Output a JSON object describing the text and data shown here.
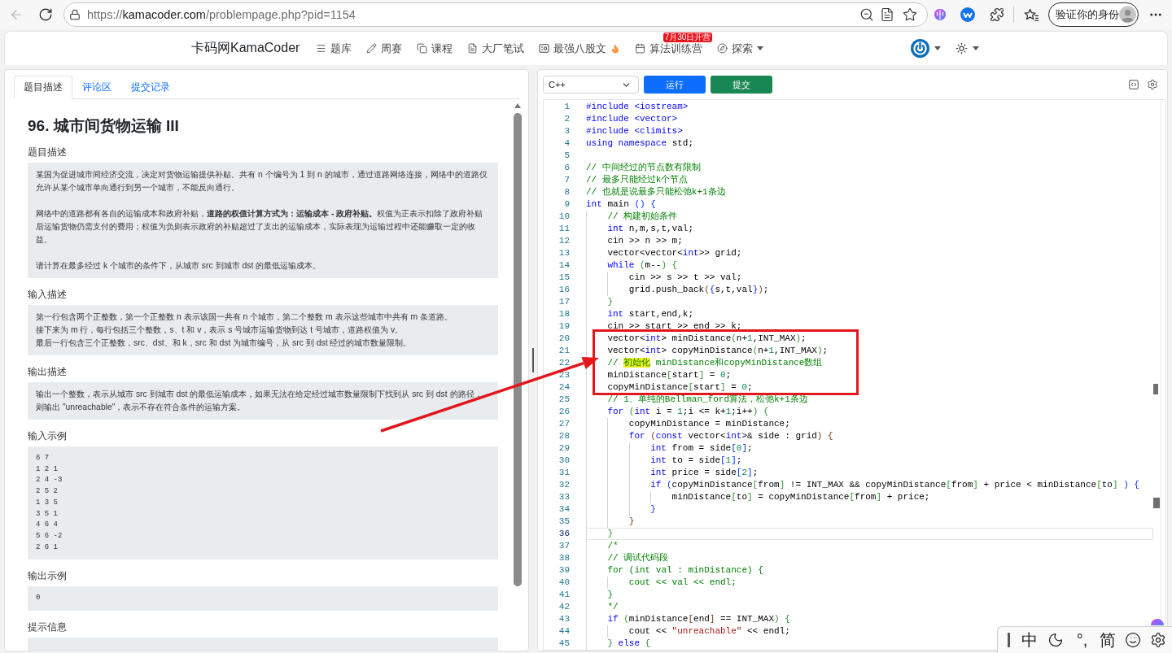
{
  "browser": {
    "back_button": {
      "disabled": true
    },
    "address": {
      "scheme": "https://",
      "host": "kamacoder.com",
      "path": "/problempage.php?pid=1154"
    },
    "profile_button": "验证你的身份"
  },
  "navbar": {
    "brand": "卡码网KamaCoder",
    "items": [
      {
        "label": "题库",
        "kind": "link"
      },
      {
        "label": "周赛",
        "kind": "link"
      },
      {
        "label": "课程",
        "kind": "link"
      },
      {
        "label": "大厂笔试",
        "kind": "link"
      },
      {
        "label": "最强八股文",
        "kind": "hot"
      },
      {
        "label": "算法训练营",
        "kind": "link",
        "badge": "7月30日开营"
      },
      {
        "label": "探索",
        "kind": "dropdown"
      }
    ]
  },
  "problem_panel": {
    "tabs": [
      {
        "label": "题目描述",
        "selected": true
      },
      {
        "label": "评论区",
        "selected": false
      },
      {
        "label": "提交记录",
        "selected": false
      }
    ],
    "title": "96. 城市间货物运输 III",
    "sections": [
      {
        "heading": "题目描述",
        "kind": "prose",
        "paragraphs": [
          "某国为促进城市间经济交流，决定对货物运输提供补贴。共有 n 个编号为 1 到 n 的城市，通过道路网络连接，网络中的道路仅允许从某个城市单向通行到另一个城市，不能反向通行。",
          "网络中的道路都有各自的运输成本和政府补贴，**道路的权值计算方式为：运输成本 - 政府补贴。**权值为正表示扣除了政府补贴后运输货物仍需支付的费用；权值为负则表示政府的补贴超过了支出的运输成本，实际表现为运输过程中还能赚取一定的收益。",
          "请计算在最多经过 k 个城市的条件下，从城市 src 到城市 dst 的最低运输成本。"
        ]
      },
      {
        "heading": "输入描述",
        "kind": "lines",
        "paragraphs": [
          "第一行包含两个正整数，第一个正整数 n 表示该国一共有 n 个城市，第二个整数 m 表示这些城市中共有 m 条道路。",
          "接下来为 m 行，每行包括三个整数，s、t 和 v，表示 s 号城市运输货物到达 t 号城市，道路权值为 v。",
          "最后一行包含三个正整数，src、dst、和 k，src 和 dst 为城市编号，从 src 到 dst 经过的城市数量限制。"
        ]
      },
      {
        "heading": "输出描述",
        "kind": "lines",
        "paragraphs": [
          "输出一个整数，表示从城市 src 到城市 dst 的最低运输成本，如果无法在给定经过城市数量限制下找到从 src 到 dst 的路径，则输出 \"unreachable\"，表示不存在符合条件的运输方案。"
        ]
      },
      {
        "heading": "输入示例",
        "kind": "sample",
        "paragraphs": [
          "6 7",
          "1 2 1",
          "2 4 -3",
          "2 5 2",
          "1 3 5",
          "3 5 1",
          "4 6 4",
          "5 6 -2",
          "2 6 1"
        ]
      },
      {
        "heading": "输出示例",
        "kind": "sample",
        "paragraphs": [
          "0"
        ]
      },
      {
        "heading": "提示信息",
        "kind": "prose"
      }
    ]
  },
  "editor": {
    "language": "C++",
    "buttons": [
      {
        "label": "运行",
        "kind": "primary"
      },
      {
        "label": "提交",
        "kind": "success"
      }
    ],
    "lines": [
      {
        "number": "1",
        "active": false,
        "tokens": [
          {
            "kind": "kw",
            "text": "#include <iostream>"
          }
        ]
      },
      {
        "number": "2",
        "active": false,
        "tokens": [
          {
            "kind": "kw",
            "text": "#include <vector>"
          }
        ]
      },
      {
        "number": "3",
        "active": false,
        "tokens": [
          {
            "kind": "kw",
            "text": "#include <climits>"
          }
        ]
      },
      {
        "number": "4",
        "active": false,
        "tokens": [
          {
            "kind": "kw",
            "text": "using namespace"
          },
          {
            "kind": "txt",
            "text": " std;"
          }
        ]
      },
      {
        "number": "5",
        "active": false
      },
      {
        "number": "6",
        "active": false,
        "tokens": [
          {
            "kind": "cm",
            "text": "// 中间经过的节点数有限制"
          }
        ]
      },
      {
        "number": "7",
        "active": false,
        "tokens": [
          {
            "kind": "cm",
            "text": "// 最多只能经过k个节点"
          }
        ]
      },
      {
        "number": "8",
        "active": false,
        "tokens": [
          {
            "kind": "cm",
            "text": "// 也就是说最多只能松弛k+1条边"
          }
        ]
      },
      {
        "number": "9",
        "active": false,
        "tokens": [
          {
            "kind": "kw",
            "text": "int"
          },
          {
            "kind": "txt",
            "text": " main "
          },
          {
            "kind": "b1",
            "text": "() {"
          }
        ],
        "children": [
          {
            "number": "10",
            "active": false,
            "tokens": [
              {
                "kind": "cm",
                "text": "// 构建初始条件"
              }
            ]
          },
          {
            "number": "11",
            "active": false,
            "tokens": [
              {
                "kind": "kw",
                "text": "int"
              },
              {
                "kind": "txt",
                "text": " n,m,s,t,val;"
              }
            ]
          },
          {
            "number": "12",
            "active": false,
            "tokens": [
              {
                "kind": "txt",
                "text": "cin >> n >> m;"
              }
            ]
          },
          {
            "number": "13",
            "active": false,
            "tokens": [
              {
                "kind": "txt",
                "text": "vector<vector<"
              },
              {
                "kind": "kw",
                "text": "int"
              },
              {
                "kind": "txt",
                "text": ">> grid;"
              }
            ]
          },
          {
            "number": "14",
            "active": false,
            "tokens": [
              {
                "kind": "kw",
                "text": "while"
              },
              {
                "kind": "b2",
                "text": " ("
              },
              {
                "kind": "txt",
                "text": "m--"
              },
              {
                "kind": "b2",
                "text": ") {"
              }
            ],
            "children": [
              {
                "number": "15",
                "active": false,
                "tokens": [
                  {
                    "kind": "txt",
                    "text": "cin >> s >> t >> val;"
                  }
                ]
              },
              {
                "number": "16",
                "active": false,
                "tokens": [
                  {
                    "kind": "txt",
                    "text": "grid.push_back"
                  },
                  {
                    "kind": "b3",
                    "text": "("
                  },
                  {
                    "kind": "b1",
                    "text": "{"
                  },
                  {
                    "kind": "txt",
                    "text": "s,t,val"
                  },
                  {
                    "kind": "b1",
                    "text": "}"
                  },
                  {
                    "kind": "b3",
                    "text": ")"
                  },
                  {
                    "kind": "txt",
                    "text": ";"
                  }
                ]
              }
            ]
          },
          {
            "number": "17",
            "active": false,
            "tokens": [
              {
                "kind": "b2",
                "text": "}"
              }
            ]
          },
          {
            "number": "18",
            "active": false,
            "tokens": [
              {
                "kind": "kw",
                "text": "int"
              },
              {
                "kind": "txt",
                "text": " start,end,k;"
              }
            ]
          },
          {
            "number": "19",
            "active": false,
            "tokens": [
              {
                "kind": "txt",
                "text": "cin >> start >> end >> k;"
              }
            ]
          },
          {
            "number": "20",
            "active": false,
            "tokens": [
              {
                "kind": "txt",
                "text": "vector<"
              },
              {
                "kind": "kw",
                "text": "int"
              },
              {
                "kind": "txt",
                "text": "> minDistance"
              },
              {
                "kind": "b2",
                "text": "("
              },
              {
                "kind": "txt",
                "text": "n+"
              },
              {
                "kind": "num",
                "text": "1"
              },
              {
                "kind": "txt",
                "text": ",INT_MAX"
              },
              {
                "kind": "b2",
                "text": ")"
              },
              {
                "kind": "txt",
                "text": ";"
              }
            ]
          },
          {
            "number": "21",
            "active": false,
            "tokens": [
              {
                "kind": "txt",
                "text": "vector<"
              },
              {
                "kind": "kw",
                "text": "int"
              },
              {
                "kind": "txt",
                "text": "> copyMinDistance"
              },
              {
                "kind": "b2",
                "text": "("
              },
              {
                "kind": "txt",
                "text": "n+"
              },
              {
                "kind": "num",
                "text": "1"
              },
              {
                "kind": "txt",
                "text": ",INT_MAX"
              },
              {
                "kind": "b2",
                "text": ")"
              },
              {
                "kind": "txt",
                "text": ";"
              }
            ]
          },
          {
            "number": "22",
            "active": false,
            "tokens": [
              {
                "kind": "cm",
                "text": "// "
              },
              {
                "kind": "cmh",
                "text": "初始化"
              },
              {
                "kind": "cm",
                "text": " minDistance和copyMinDistance数组"
              }
            ]
          },
          {
            "number": "23",
            "active": false,
            "tokens": [
              {
                "kind": "txt",
                "text": "minDistance"
              },
              {
                "kind": "b2",
                "text": "["
              },
              {
                "kind": "txt",
                "text": "start"
              },
              {
                "kind": "b2",
                "text": "]"
              },
              {
                "kind": "txt",
                "text": " = "
              },
              {
                "kind": "num",
                "text": "0"
              },
              {
                "kind": "txt",
                "text": ";"
              }
            ]
          },
          {
            "number": "24",
            "active": false,
            "tokens": [
              {
                "kind": "txt",
                "text": "copyMinDistance"
              },
              {
                "kind": "b2",
                "text": "["
              },
              {
                "kind": "txt",
                "text": "start"
              },
              {
                "kind": "b2",
                "text": "]"
              },
              {
                "kind": "txt",
                "text": " = "
              },
              {
                "kind": "num",
                "text": "0"
              },
              {
                "kind": "txt",
                "text": ";"
              }
            ]
          },
          {
            "number": "25",
            "active": false,
            "tokens": [
              {
                "kind": "cm",
                "text": "// 1、单纯的Bellman_ford算法，松弛k+1条边"
              }
            ]
          },
          {
            "number": "26",
            "active": false,
            "tokens": [
              {
                "kind": "kw",
                "text": "for"
              },
              {
                "kind": "b2",
                "text": " ("
              },
              {
                "kind": "kw",
                "text": "int"
              },
              {
                "kind": "txt",
                "text": " i = "
              },
              {
                "kind": "num",
                "text": "1"
              },
              {
                "kind": "txt",
                "text": ";i <= k+"
              },
              {
                "kind": "num",
                "text": "1"
              },
              {
                "kind": "txt",
                "text": ";i++"
              },
              {
                "kind": "b2",
                "text": ") {"
              }
            ],
            "children": [
              {
                "number": "27",
                "active": false,
                "tokens": [
                  {
                    "kind": "txt",
                    "text": "copyMinDistance = minDistance;"
                  }
                ]
              },
              {
                "number": "28",
                "active": false,
                "tokens": [
                  {
                    "kind": "kw",
                    "text": "for"
                  },
                  {
                    "kind": "b3",
                    "text": " ("
                  },
                  {
                    "kind": "kw",
                    "text": "const"
                  },
                  {
                    "kind": "txt",
                    "text": " vector<"
                  },
                  {
                    "kind": "kw",
                    "text": "int"
                  },
                  {
                    "kind": "txt",
                    "text": ">& side : grid"
                  },
                  {
                    "kind": "b3",
                    "text": ") {"
                  }
                ],
                "children": [
                  {
                    "number": "29",
                    "active": false,
                    "tokens": [
                      {
                        "kind": "kw",
                        "text": "int"
                      },
                      {
                        "kind": "txt",
                        "text": " from = side"
                      },
                      {
                        "kind": "b1",
                        "text": "["
                      },
                      {
                        "kind": "num",
                        "text": "0"
                      },
                      {
                        "kind": "b1",
                        "text": "]"
                      },
                      {
                        "kind": "txt",
                        "text": ";"
                      }
                    ]
                  },
                  {
                    "number": "30",
                    "active": false,
                    "tokens": [
                      {
                        "kind": "kw",
                        "text": "int"
                      },
                      {
                        "kind": "txt",
                        "text": " to = side"
                      },
                      {
                        "kind": "b1",
                        "text": "["
                      },
                      {
                        "kind": "num",
                        "text": "1"
                      },
                      {
                        "kind": "b1",
                        "text": "]"
                      },
                      {
                        "kind": "txt",
                        "text": ";"
                      }
                    ]
                  },
                  {
                    "number": "31",
                    "active": false,
                    "tokens": [
                      {
                        "kind": "kw",
                        "text": "int"
                      },
                      {
                        "kind": "txt",
                        "text": " price = side"
                      },
                      {
                        "kind": "b1",
                        "text": "["
                      },
                      {
                        "kind": "num",
                        "text": "2"
                      },
                      {
                        "kind": "b1",
                        "text": "]"
                      },
                      {
                        "kind": "txt",
                        "text": ";"
                      }
                    ]
                  },
                  {
                    "number": "32",
                    "active": false,
                    "tokens": [
                      {
                        "kind": "kw",
                        "text": "if"
                      },
                      {
                        "kind": "b1",
                        "text": " ("
                      },
                      {
                        "kind": "txt",
                        "text": "copyMinDistance"
                      },
                      {
                        "kind": "b2",
                        "text": "["
                      },
                      {
                        "kind": "txt",
                        "text": "from"
                      },
                      {
                        "kind": "b2",
                        "text": "]"
                      },
                      {
                        "kind": "txt",
                        "text": " != INT_MAX && copyMinDistance"
                      },
                      {
                        "kind": "b2",
                        "text": "["
                      },
                      {
                        "kind": "txt",
                        "text": "from"
                      },
                      {
                        "kind": "b2",
                        "text": "]"
                      },
                      {
                        "kind": "txt",
                        "text": " + price < minDistance"
                      },
                      {
                        "kind": "b2",
                        "text": "["
                      },
                      {
                        "kind": "txt",
                        "text": "to"
                      },
                      {
                        "kind": "b2",
                        "text": "]"
                      },
                      {
                        "kind": "b1",
                        "text": " ) {"
                      }
                    ],
                    "children": [
                      {
                        "number": "33",
                        "active": false,
                        "tokens": [
                          {
                            "kind": "txt",
                            "text": "minDistance"
                          },
                          {
                            "kind": "b2",
                            "text": "["
                          },
                          {
                            "kind": "txt",
                            "text": "to"
                          },
                          {
                            "kind": "b2",
                            "text": "]"
                          },
                          {
                            "kind": "txt",
                            "text": " = copyMinDistance"
                          },
                          {
                            "kind": "b2",
                            "text": "["
                          },
                          {
                            "kind": "txt",
                            "text": "from"
                          },
                          {
                            "kind": "b2",
                            "text": "]"
                          },
                          {
                            "kind": "txt",
                            "text": " + price;"
                          }
                        ]
                      }
                    ]
                  },
                  {
                    "number": "34",
                    "active": false,
                    "tokens": [
                      {
                        "kind": "b1",
                        "text": "}"
                      }
                    ]
                  }
                ]
              },
              {
                "number": "35",
                "active": false,
                "tokens": [
                  {
                    "kind": "b3",
                    "text": "}"
                  }
                ]
              }
            ]
          },
          {
            "number": "36",
            "active": true,
            "tokens": [
              {
                "kind": "b2",
                "text": "}"
              }
            ]
          },
          {
            "number": "37",
            "active": false,
            "tokens": [
              {
                "kind": "cm",
                "text": "/*"
              }
            ]
          },
          {
            "number": "38",
            "active": false,
            "tokens": [
              {
                "kind": "cm",
                "text": "// 调试代码段"
              }
            ]
          },
          {
            "number": "39",
            "active": false,
            "tokens": [
              {
                "kind": "cm",
                "text": "for (int val : minDistance) {"
              }
            ],
            "children": [
              {
                "number": "40",
                "active": false,
                "tokens": [
                  {
                    "kind": "cm",
                    "text": "cout << val << endl;"
                  }
                ]
              }
            ]
          },
          {
            "number": "41",
            "active": false,
            "tokens": [
              {
                "kind": "cm",
                "text": "}"
              }
            ]
          },
          {
            "number": "42",
            "active": false,
            "tokens": [
              {
                "kind": "cm",
                "text": "*/"
              }
            ]
          },
          {
            "number": "43",
            "active": false,
            "tokens": [
              {
                "kind": "kw",
                "text": "if"
              },
              {
                "kind": "b2",
                "text": " ("
              },
              {
                "kind": "txt",
                "text": "minDistance"
              },
              {
                "kind": "b3",
                "text": "["
              },
              {
                "kind": "txt",
                "text": "end"
              },
              {
                "kind": "b3",
                "text": "]"
              },
              {
                "kind": "txt",
                "text": " == INT_MAX"
              },
              {
                "kind": "b2",
                "text": ") {"
              }
            ],
            "children": [
              {
                "number": "44",
                "active": false,
                "tokens": [
                  {
                    "kind": "txt",
                    "text": "cout << "
                  },
                  {
                    "kind": "str",
                    "text": "\"unreachable\""
                  },
                  {
                    "kind": "txt",
                    "text": " << endl;"
                  }
                ]
              }
            ]
          },
          {
            "number": "45",
            "active": false,
            "tokens": [
              {
                "kind": "b2",
                "text": "} "
              },
              {
                "kind": "kw",
                "text": "else"
              },
              {
                "kind": "b2",
                "text": " {"
              }
            ]
          }
        ]
      }
    ]
  },
  "ime_bar": {
    "mode": "中",
    "punctuation": "°,",
    "script": "简"
  }
}
